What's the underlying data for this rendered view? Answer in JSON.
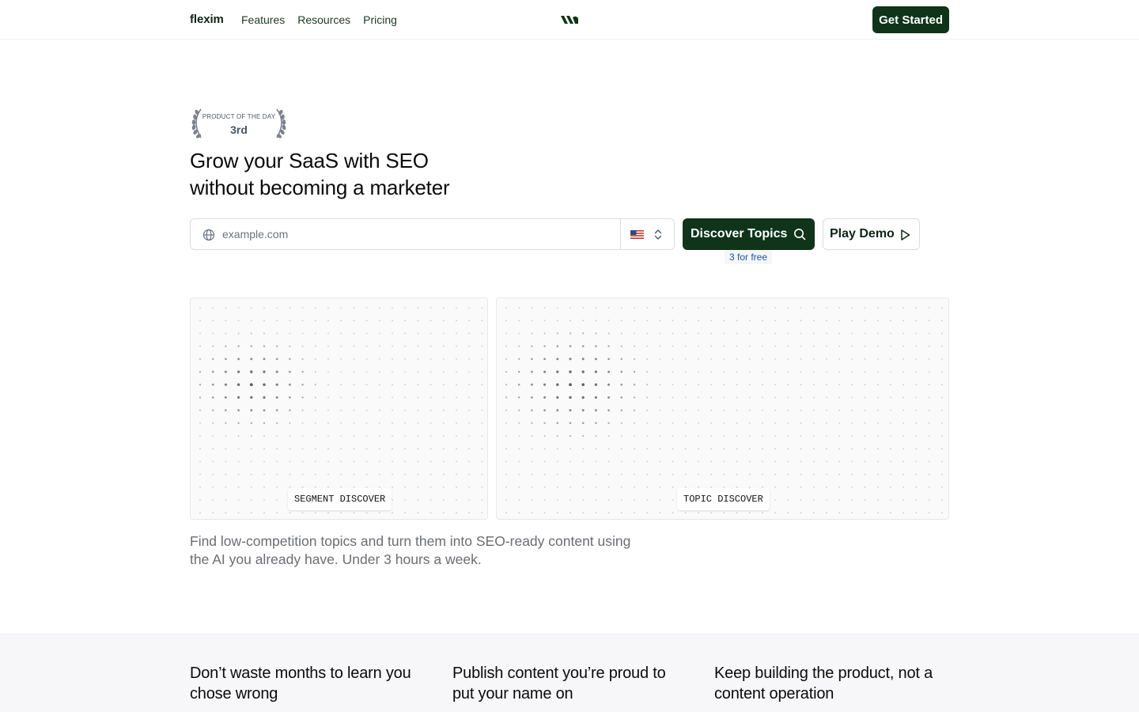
{
  "nav": {
    "brand": "flexim",
    "links": [
      "Features",
      "Resources",
      "Pricing"
    ],
    "cta": "Get Started"
  },
  "badge": {
    "title": "PRODUCT OF THE DAY",
    "rank": "3rd"
  },
  "hero": {
    "headline_line1": "Grow your SaaS with SEO",
    "headline_line2": "without becoming a marketer",
    "url_placeholder": "example.com",
    "country_flag": "us-flag-icon",
    "discover_button": "Discover Topics",
    "free_note": "3 for free",
    "demo_button": "Play Demo",
    "subtext": "Find low-competition topics and turn them into SEO-ready content using the AI you already have. Under 3 hours a week."
  },
  "panels": {
    "segment_label": "SEGMENT DISCOVER",
    "topic_label": "TOPIC DISCOVER"
  },
  "features": [
    {
      "title": "Don’t waste months to learn you chose wrong",
      "desc": ""
    },
    {
      "title": "Publish content you’re proud to put your name on",
      "desc": ""
    },
    {
      "title": "Keep building the product, not a content operation",
      "desc": ""
    }
  ],
  "colors": {
    "primary": "#0f3419",
    "free_note_text": "#1f55a6",
    "muted_text": "#6b6d72"
  }
}
